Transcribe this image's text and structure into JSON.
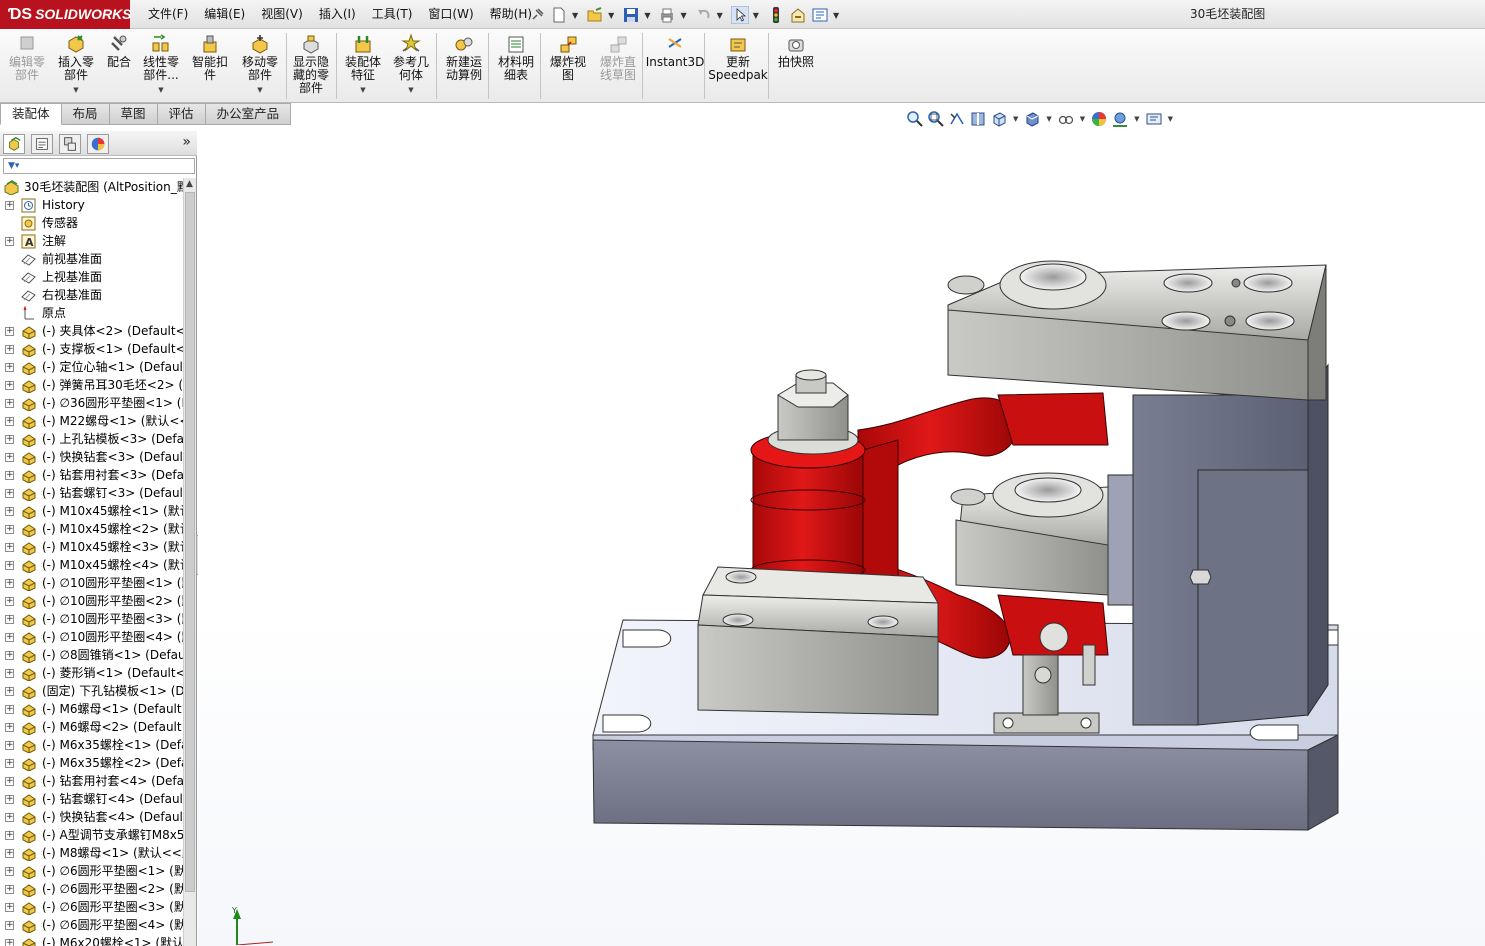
{
  "app": {
    "brand": "SOLIDWORKS",
    "brand_prefix": "ƊS",
    "document_title": "30毛坯装配图"
  },
  "menu": [
    "文件(F)",
    "编辑(E)",
    "视图(V)",
    "插入(I)",
    "工具(T)",
    "窗口(W)",
    "帮助(H)"
  ],
  "commands": [
    {
      "label1": "编辑零",
      "label2": "部件",
      "label3": "",
      "disabled": true,
      "icon": "edit-component-icon"
    },
    {
      "label1": "插入零",
      "label2": "部件",
      "label3": "",
      "dropdown": true,
      "icon": "insert-component-icon"
    },
    {
      "label1": "配合",
      "label2": "",
      "label3": "",
      "icon": "mate-icon"
    },
    {
      "label1": "线性零",
      "label2": "部件...",
      "label3": "",
      "dropdown": true,
      "icon": "linear-pattern-icon"
    },
    {
      "label1": "智能扣",
      "label2": "件",
      "label3": "",
      "icon": "smart-fasteners-icon"
    },
    {
      "label1": "移动零",
      "label2": "部件",
      "label3": "",
      "dropdown": true,
      "icon": "move-component-icon"
    },
    {
      "label1": "显示隐",
      "label2": "藏的零",
      "label3": "部件",
      "icon": "show-hidden-icon"
    },
    {
      "label1": "装配体",
      "label2": "特征",
      "label3": "",
      "dropdown": true,
      "icon": "assembly-features-icon"
    },
    {
      "label1": "参考几",
      "label2": "何体",
      "label3": "",
      "dropdown": true,
      "icon": "reference-geometry-icon"
    },
    {
      "label1": "新建运",
      "label2": "动算例",
      "label3": "",
      "icon": "new-motion-study-icon"
    },
    {
      "label1": "材料明",
      "label2": "细表",
      "label3": "",
      "icon": "bill-of-materials-icon"
    },
    {
      "label1": "爆炸视",
      "label2": "图",
      "label3": "",
      "icon": "exploded-view-icon"
    },
    {
      "label1": "爆炸直",
      "label2": "线草图",
      "label3": "",
      "disabled": true,
      "icon": "explode-line-sketch-icon"
    },
    {
      "label1": "Instant3D",
      "label2": "",
      "label3": "",
      "icon": "instant3d-icon"
    },
    {
      "label1": "更新",
      "label2": "Speedpak",
      "label3": "",
      "icon": "update-speedpak-icon"
    },
    {
      "label1": "拍快照",
      "label2": "",
      "label3": "",
      "icon": "take-snapshot-icon"
    }
  ],
  "tabs": [
    "装配体",
    "布局",
    "草图",
    "评估",
    "办公室产品"
  ],
  "active_tab": "装配体",
  "feature_tree": {
    "root": "30毛坯装配图  (AltPosition_默",
    "items": [
      {
        "label": "History",
        "expandable": true,
        "icon": "history-icon"
      },
      {
        "label": "传感器",
        "expandable": false,
        "icon": "sensor-icon"
      },
      {
        "label": "注解",
        "expandable": true,
        "icon": "annotation-icon"
      },
      {
        "label": "前视基准面",
        "expandable": false,
        "icon": "plane-icon"
      },
      {
        "label": "上视基准面",
        "expandable": false,
        "icon": "plane-icon"
      },
      {
        "label": "右视基准面",
        "expandable": false,
        "icon": "plane-icon"
      },
      {
        "label": "原点",
        "expandable": false,
        "icon": "origin-icon"
      },
      {
        "label": "(-) 夹具体<2> (Default<<",
        "expandable": true,
        "icon": "part-icon"
      },
      {
        "label": "(-) 支撑板<1> (Default<<",
        "expandable": true,
        "icon": "part-icon"
      },
      {
        "label": "(-) 定位心轴<1> (Default",
        "expandable": true,
        "icon": "part-icon"
      },
      {
        "label": "(-) 弹簧吊耳30毛坯<2> (默",
        "expandable": true,
        "icon": "part-icon"
      },
      {
        "label": "(-) ∅36圆形平垫圈<1> (D",
        "expandable": true,
        "icon": "part-icon"
      },
      {
        "label": "(-) M22螺母<1> (默认<<",
        "expandable": true,
        "icon": "part-icon"
      },
      {
        "label": "(-) 上孔钻模板<3> (Defau",
        "expandable": true,
        "icon": "part-icon"
      },
      {
        "label": "(-) 快换钻套<3> (Default",
        "expandable": true,
        "icon": "part-icon"
      },
      {
        "label": "(-) 钻套用衬套<3> (Defau",
        "expandable": true,
        "icon": "part-icon"
      },
      {
        "label": "(-) 钻套螺钉<3> (Default",
        "expandable": true,
        "icon": "part-icon"
      },
      {
        "label": "(-) M10x45螺栓<1> (默认",
        "expandable": true,
        "icon": "part-icon"
      },
      {
        "label": "(-) M10x45螺栓<2> (默认",
        "expandable": true,
        "icon": "part-icon"
      },
      {
        "label": "(-) M10x45螺栓<3> (默认",
        "expandable": true,
        "icon": "part-icon"
      },
      {
        "label": "(-) M10x45螺栓<4> (默认",
        "expandable": true,
        "icon": "part-icon"
      },
      {
        "label": "(-) ∅10圆形平垫圈<1> (默",
        "expandable": true,
        "icon": "part-icon"
      },
      {
        "label": "(-) ∅10圆形平垫圈<2> (默",
        "expandable": true,
        "icon": "part-icon"
      },
      {
        "label": "(-) ∅10圆形平垫圈<3> (默",
        "expandable": true,
        "icon": "part-icon"
      },
      {
        "label": "(-) ∅10圆形平垫圈<4> (默",
        "expandable": true,
        "icon": "part-icon"
      },
      {
        "label": "(-) ∅8圆锥销<1> (Defau",
        "expandable": true,
        "icon": "part-icon"
      },
      {
        "label": "(-) 菱形销<1> (Default<<",
        "expandable": true,
        "icon": "part-icon"
      },
      {
        "label": "(固定) 下孔钻模板<1> (D",
        "expandable": true,
        "icon": "part-icon"
      },
      {
        "label": "(-) M6螺母<1> (Default<",
        "expandable": true,
        "icon": "part-icon"
      },
      {
        "label": "(-) M6螺母<2> (Default<",
        "expandable": true,
        "icon": "part-icon"
      },
      {
        "label": "(-) M6x35螺栓<1> (Defa",
        "expandable": true,
        "icon": "part-icon"
      },
      {
        "label": "(-) M6x35螺栓<2> (Defa",
        "expandable": true,
        "icon": "part-icon"
      },
      {
        "label": "(-) 钻套用衬套<4> (Defau",
        "expandable": true,
        "icon": "part-icon"
      },
      {
        "label": "(-) 钻套螺钉<4> (Default",
        "expandable": true,
        "icon": "part-icon"
      },
      {
        "label": "(-) 快换钻套<4> (Default",
        "expandable": true,
        "icon": "part-icon"
      },
      {
        "label": "(-) A型调节支承螺钉M8x5",
        "expandable": true,
        "icon": "part-icon"
      },
      {
        "label": "(-) M8螺母<1> (默认<<默",
        "expandable": true,
        "icon": "part-icon"
      },
      {
        "label": "(-) ∅6圆形平垫圈<1> (默",
        "expandable": true,
        "icon": "part-icon"
      },
      {
        "label": "(-) ∅6圆形平垫圈<2> (默",
        "expandable": true,
        "icon": "part-icon"
      },
      {
        "label": "(-) ∅6圆形平垫圈<3> (默",
        "expandable": true,
        "icon": "part-icon"
      },
      {
        "label": "(-) ∅6圆形平垫圈<4> (默",
        "expandable": true,
        "icon": "part-icon"
      },
      {
        "label": "(-) M6x20螺栓<1> (默认",
        "expandable": true,
        "icon": "part-icon"
      }
    ]
  },
  "triad_label": "Y",
  "colors": {
    "accent_red": "#d41414",
    "brand_red": "#b8121e",
    "steel": "#b8b8b4",
    "plate_blue": "#e4e8f4"
  }
}
